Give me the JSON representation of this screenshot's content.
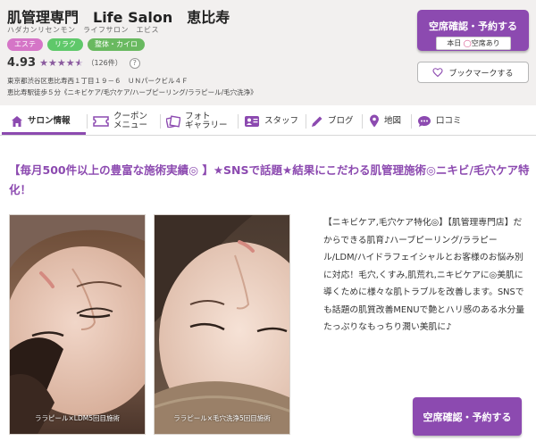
{
  "header": {
    "salon_name": "肌管理専門　Life Salon　恵比寿",
    "salon_kana": "ハダカンリセンモン　ライフサロン　エビス",
    "tags": [
      "エステ",
      "リラク",
      "整体・カイロ"
    ],
    "rating": "4.93",
    "rating_stars": 4.5,
    "review_count": "（126件）",
    "help_label": "?",
    "address": "東京都渋谷区恵比寿西１丁目１９－６　ＵＮパークビル４Ｆ",
    "access": "恵比寿駅徒歩５分《ニキビケア/毛穴ケア/ハーブピーリング/ララピール/毛穴洗浄》",
    "reserve_label": "空席確認・予約する",
    "availability_day": "本日",
    "availability_mark": "◯",
    "availability_text": "空席あり",
    "bookmark_label": "ブックマークする"
  },
  "nav": {
    "items": [
      {
        "label": "サロン情報",
        "icon": "home-icon"
      },
      {
        "label": "クーポン\nメニュー",
        "icon": "coupon-icon"
      },
      {
        "label": "フォト\nギャラリー",
        "icon": "photo-icon"
      },
      {
        "label": "スタッフ",
        "icon": "staff-icon"
      },
      {
        "label": "ブログ",
        "icon": "pencil-icon"
      },
      {
        "label": "地図",
        "icon": "map-pin-icon"
      },
      {
        "label": "口コミ",
        "icon": "chat-icon"
      }
    ]
  },
  "main": {
    "headline": "【毎月500件以上の豊富な施術実績◎ 】★SNSで話題★結果にこだわる肌管理施術◎ニキビ/毛穴ケア特化！",
    "photos": [
      {
        "caption": "ララピール×LDM5回目施術"
      },
      {
        "caption": "ララピール×毛穴洗浄5回目施術"
      }
    ],
    "description": "【ニキビケア,毛穴ケア特化◎】【肌管理専門店】だからできる肌育♪ハーブピーリング/ララピール/LDM/ハイドラフェイシャルとお客様のお悩み別に対応！毛穴,くすみ,肌荒れ,ニキビケアに◎美肌に導くために様々な肌トラブルを改善します。SNSでも話題の肌質改善MENUで艶とハリ感のある水分量たっぷりなもっちり潤い美肌に♪",
    "reserve_label": "空席確認・予約する"
  },
  "colors": {
    "brand_purple": "#8c4ab0",
    "header_bg": "#f2f0ef",
    "tag_este": "#d575c7",
    "tag_relax": "#5fc86a"
  }
}
